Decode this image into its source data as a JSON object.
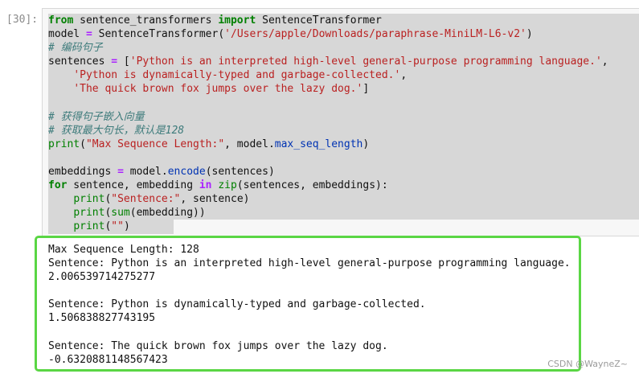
{
  "cell": {
    "prompt": "[30]:",
    "code_lines": [
      [
        {
          "t": "kw",
          "v": "from"
        },
        {
          "t": "",
          "v": " sentence_transformers "
        },
        {
          "t": "kw",
          "v": "import"
        },
        {
          "t": "",
          "v": " SentenceTransformer"
        }
      ],
      [
        {
          "t": "",
          "v": "model "
        },
        {
          "t": "op",
          "v": "="
        },
        {
          "t": "",
          "v": " SentenceTransformer("
        },
        {
          "t": "str",
          "v": "'/Users/apple/Downloads/paraphrase-MiniLM-L6-v2'"
        },
        {
          "t": "",
          "v": ")"
        }
      ],
      [
        {
          "t": "cm",
          "v": "# 编码句子"
        }
      ],
      [
        {
          "t": "",
          "v": "sentences "
        },
        {
          "t": "op",
          "v": "="
        },
        {
          "t": "",
          "v": " ["
        },
        {
          "t": "str",
          "v": "'Python is an interpreted high-level general-purpose programming language.'"
        },
        {
          "t": "",
          "v": ","
        }
      ],
      [
        {
          "t": "",
          "v": "    "
        },
        {
          "t": "str",
          "v": "'Python is dynamically-typed and garbage-collected.'"
        },
        {
          "t": "",
          "v": ","
        }
      ],
      [
        {
          "t": "",
          "v": "    "
        },
        {
          "t": "str",
          "v": "'The quick brown fox jumps over the lazy dog.'"
        },
        {
          "t": "",
          "v": "]"
        }
      ],
      [
        {
          "t": "",
          "v": ""
        }
      ],
      [
        {
          "t": "cm",
          "v": "# 获得句子嵌入向量"
        }
      ],
      [
        {
          "t": "cm",
          "v": "# 获取最大句长，默认是128"
        }
      ],
      [
        {
          "t": "fn",
          "v": "print"
        },
        {
          "t": "",
          "v": "("
        },
        {
          "t": "str",
          "v": "\"Max Sequence Length:\""
        },
        {
          "t": "",
          "v": ", model."
        },
        {
          "t": "attr",
          "v": "max_seq_length"
        },
        {
          "t": "",
          "v": ")"
        }
      ],
      [
        {
          "t": "",
          "v": ""
        }
      ],
      [
        {
          "t": "",
          "v": "embeddings "
        },
        {
          "t": "op",
          "v": "="
        },
        {
          "t": "",
          "v": " model."
        },
        {
          "t": "attr",
          "v": "encode"
        },
        {
          "t": "",
          "v": "(sentences)"
        }
      ],
      [
        {
          "t": "kw",
          "v": "for"
        },
        {
          "t": "",
          "v": " sentence, embedding "
        },
        {
          "t": "op",
          "v": "in"
        },
        {
          "t": "",
          "v": " "
        },
        {
          "t": "fn",
          "v": "zip"
        },
        {
          "t": "",
          "v": "(sentences, embeddings):"
        }
      ],
      [
        {
          "t": "",
          "v": "    "
        },
        {
          "t": "fn",
          "v": "print"
        },
        {
          "t": "",
          "v": "("
        },
        {
          "t": "str",
          "v": "\"Sentence:\""
        },
        {
          "t": "",
          "v": ", sentence)"
        }
      ],
      [
        {
          "t": "",
          "v": "    "
        },
        {
          "t": "fn",
          "v": "print"
        },
        {
          "t": "",
          "v": "("
        },
        {
          "t": "fn",
          "v": "sum"
        },
        {
          "t": "",
          "v": "(embedding))"
        }
      ],
      [
        {
          "t": "",
          "v": "    "
        },
        {
          "t": "fn",
          "v": "print"
        },
        {
          "t": "",
          "v": "("
        },
        {
          "t": "str",
          "v": "\"\""
        },
        {
          "t": "",
          "v": ")"
        }
      ]
    ],
    "output_lines": [
      "Max Sequence Length: 128",
      "Sentence: Python is an interpreted high-level general-purpose programming language.",
      "2.006539714275277",
      "",
      "Sentence: Python is dynamically-typed and garbage-collected.",
      "1.506838827743195",
      "",
      "Sentence: The quick brown fox jumps over the lazy dog.",
      "-0.6320881148567423"
    ]
  },
  "watermark": "CSDN @WayneZ~",
  "colors": {
    "output_border": "#5ad644",
    "keyword": "#008000",
    "string": "#ba2121",
    "comment": "#3d7b7b"
  }
}
